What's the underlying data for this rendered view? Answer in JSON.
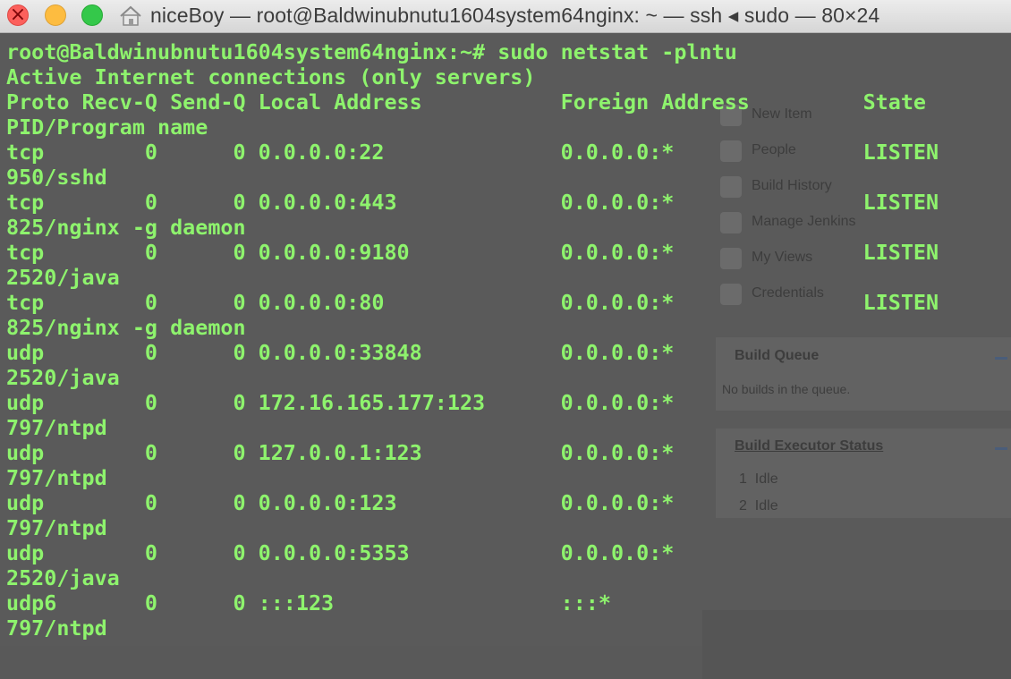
{
  "window": {
    "title": "niceBoy — root@Baldwinubnutu1604system64nginx: ~ — ssh ◂ sudo — 80×24",
    "buttons": [
      "close",
      "minimize",
      "zoom"
    ],
    "icon": "home-icon"
  },
  "colors": {
    "terminal_text": "#8ef36d",
    "background": "#595959",
    "titlebar": "#e3e3e3"
  },
  "terminal": {
    "prompt": "root@Baldwinubnutu1604system64nginx:~# sudo netstat -plntu",
    "header1": "Active Internet connections (only servers)",
    "header2": "Proto Recv-Q Send-Q Local Address           Foreign Address         State",
    "header3": "PID/Program name",
    "rows": [
      {
        "proto": "tcp",
        "recvq": "0",
        "sendq": "0",
        "local": "0.0.0.0:22",
        "foreign": "0.0.0.0:*",
        "state": "LISTEN",
        "pid": "950/sshd"
      },
      {
        "proto": "tcp",
        "recvq": "0",
        "sendq": "0",
        "local": "0.0.0.0:443",
        "foreign": "0.0.0.0:*",
        "state": "LISTEN",
        "pid": "825/nginx -g daemon"
      },
      {
        "proto": "tcp",
        "recvq": "0",
        "sendq": "0",
        "local": "0.0.0.0:9180",
        "foreign": "0.0.0.0:*",
        "state": "LISTEN",
        "pid": "2520/java"
      },
      {
        "proto": "tcp",
        "recvq": "0",
        "sendq": "0",
        "local": "0.0.0.0:80",
        "foreign": "0.0.0.0:*",
        "state": "LISTEN",
        "pid": "825/nginx -g daemon"
      },
      {
        "proto": "udp",
        "recvq": "0",
        "sendq": "0",
        "local": "0.0.0.0:33848",
        "foreign": "0.0.0.0:*",
        "state": "",
        "pid": "2520/java"
      },
      {
        "proto": "udp",
        "recvq": "0",
        "sendq": "0",
        "local": "172.16.165.177:123",
        "foreign": "0.0.0.0:*",
        "state": "",
        "pid": "797/ntpd"
      },
      {
        "proto": "udp",
        "recvq": "0",
        "sendq": "0",
        "local": "127.0.0.1:123",
        "foreign": "0.0.0.0:*",
        "state": "",
        "pid": "797/ntpd"
      },
      {
        "proto": "udp",
        "recvq": "0",
        "sendq": "0",
        "local": "0.0.0.0:123",
        "foreign": "0.0.0.0:*",
        "state": "",
        "pid": "797/ntpd"
      },
      {
        "proto": "udp",
        "recvq": "0",
        "sendq": "0",
        "local": "0.0.0.0:5353",
        "foreign": "0.0.0.0:*",
        "state": "",
        "pid": "2520/java"
      },
      {
        "proto": "udp6",
        "recvq": "0",
        "sendq": "0",
        "local": ":::123",
        "foreign": ":::*",
        "state": "",
        "pid": "797/ntpd"
      }
    ]
  },
  "background_page": {
    "tasks": [
      {
        "label": "New Item",
        "icon": "folder-icon"
      },
      {
        "label": "People",
        "icon": "people-icon"
      },
      {
        "label": "Build History",
        "icon": "notepad-icon"
      },
      {
        "label": "Manage Jenkins",
        "icon": "gear-icon"
      },
      {
        "label": "My Views",
        "icon": "users-icon"
      },
      {
        "label": "Credentials",
        "icon": "key-icon"
      }
    ],
    "build_queue": {
      "title": "Build Queue",
      "empty_text": "No builds in the queue."
    },
    "executor_status": {
      "title": "Build Executor Status",
      "executors": [
        {
          "num": "1",
          "status": "Idle"
        },
        {
          "num": "2",
          "status": "Idle"
        }
      ]
    }
  }
}
